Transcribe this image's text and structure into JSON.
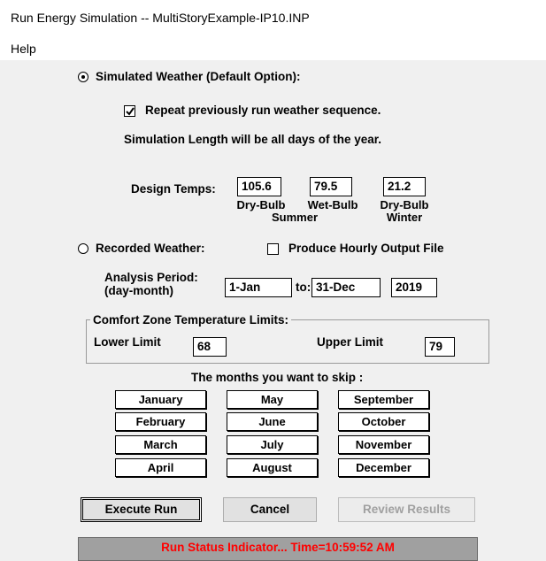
{
  "window": {
    "title": "Run Energy Simulation -- MultiStoryExample-IP10.INP"
  },
  "menu": {
    "help": "Help"
  },
  "weather": {
    "simulated_label": "Simulated Weather (Default Option):",
    "simulated_selected": true,
    "repeat_label": "Repeat previously run weather sequence.",
    "repeat_checked": true,
    "sim_length_text": "Simulation Length will be all days of the year.",
    "recorded_label": "Recorded Weather:",
    "recorded_selected": false,
    "hourly_label": "Produce Hourly Output File",
    "hourly_checked": false
  },
  "design_temps": {
    "label": "Design Temps:",
    "dry_bulb_summer": "105.6",
    "wet_bulb_summer": "79.5",
    "dry_bulb_winter": "21.2",
    "cap_dry_bulb": "Dry-Bulb",
    "cap_wet_bulb": "Wet-Bulb",
    "cap_summer": "Summer",
    "cap_dry_bulb_winter": "Dry-Bulb",
    "cap_winter": "Winter"
  },
  "analysis": {
    "label_line1": "Analysis Period:",
    "label_line2": "(day-month)",
    "start": "1-Jan",
    "to_label": "to:",
    "end": "31-Dec",
    "year": "2019"
  },
  "comfort": {
    "group_label": "Comfort Zone Temperature Limits:",
    "lower_label": "Lower Limit",
    "lower_value": "68",
    "upper_label": "Upper Limit",
    "upper_value": "79"
  },
  "months": {
    "heading": "The months you want to skip :",
    "col1": [
      "January",
      "February",
      "March",
      "April"
    ],
    "col2": [
      "May",
      "June",
      "July",
      "August"
    ],
    "col3": [
      "September",
      "October",
      "November",
      "December"
    ]
  },
  "actions": {
    "execute": "Execute Run",
    "cancel": "Cancel",
    "review": "Review Results"
  },
  "status": {
    "text": "Run Status Indicator...  Time=10:59:52 AM"
  }
}
